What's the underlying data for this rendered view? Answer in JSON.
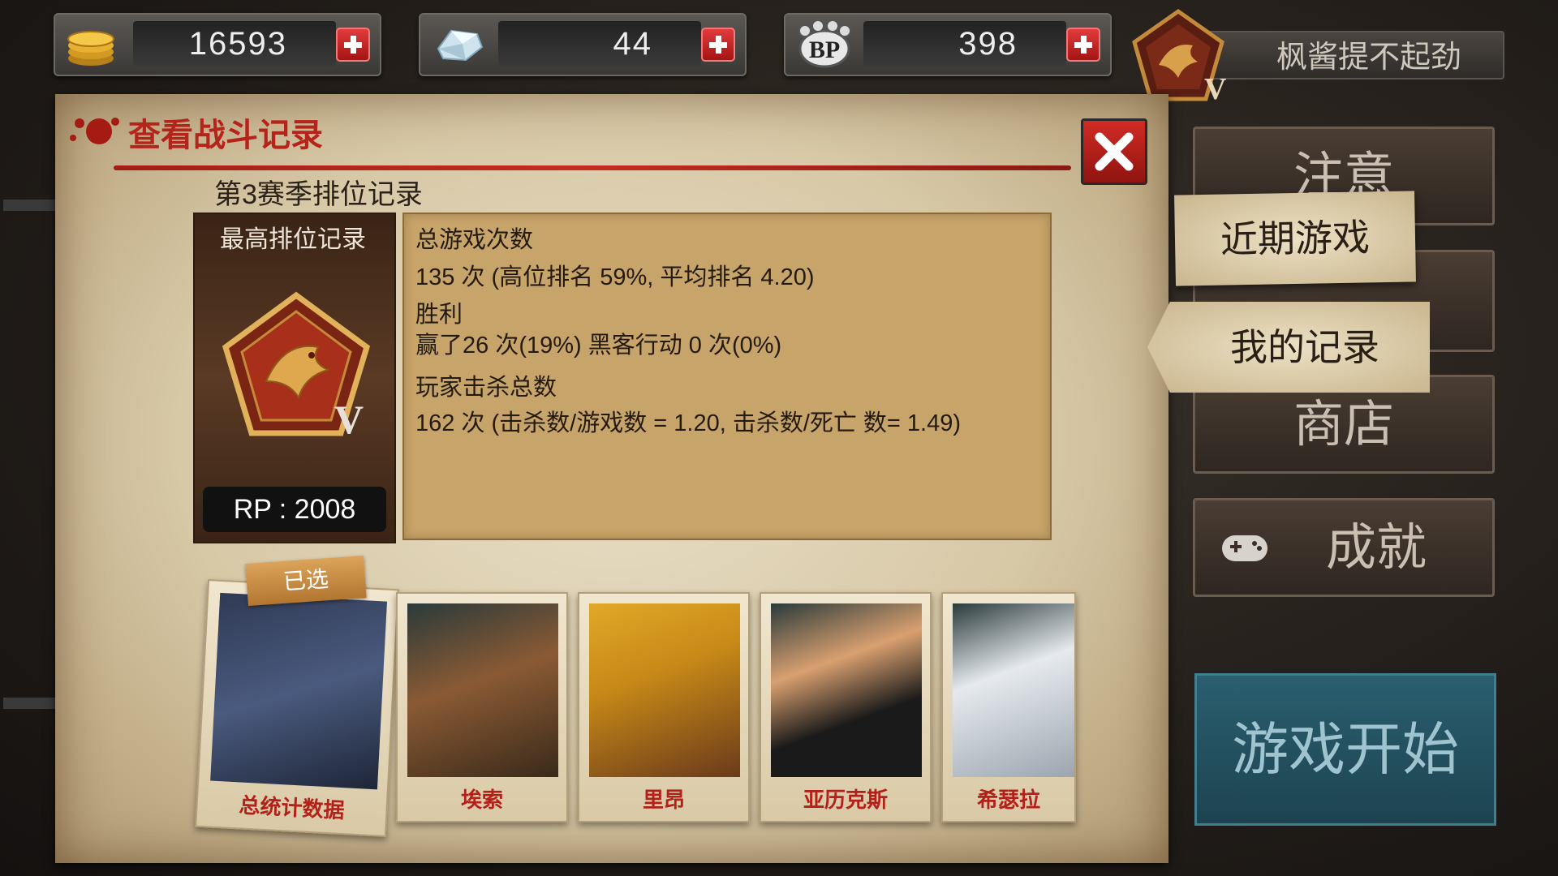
{
  "currency": {
    "gold": {
      "icon": "gold-coins-icon",
      "value": "16593"
    },
    "gem": {
      "icon": "crystal-icon",
      "value": "44"
    },
    "bp": {
      "icon": "bp-paw-icon",
      "value": "398"
    }
  },
  "player": {
    "name": "枫酱提不起劲",
    "rank_tier": "V"
  },
  "dialog": {
    "title": "查看战斗记录",
    "season_title": "第3赛季排位记录",
    "best_rank": {
      "label": "最高排位记录",
      "tier": "V",
      "rp": "RP : 2008"
    },
    "stats": {
      "games_label": "总游戏次数",
      "games_value": "135 次 (高位排名 59%, 平均排名 4.20)",
      "wins_label": "胜利",
      "wins_value": "赢了26 次(19%) 黑客行动 0 次(0%)",
      "kills_label": "玩家击杀总数",
      "kills_value": "162 次 (击杀数/游戏数 = 1.20, 击杀数/死亡 数= 1.49)"
    },
    "selected_badge": "已选",
    "characters": [
      {
        "name": "总统计数据",
        "color": "#3a4a6a"
      },
      {
        "name": "埃索",
        "color": "#6a4a2a"
      },
      {
        "name": "里昂",
        "color": "#d9a020"
      },
      {
        "name": "亚历克斯",
        "color": "#2a2a2a"
      },
      {
        "name": "希瑟拉",
        "color": "#cfd6de"
      }
    ]
  },
  "menu": {
    "notice": "注意",
    "recent_games": "近期游戏",
    "my_records": "我的记录",
    "shop": "商店",
    "achievements": "成就",
    "start_game": "游戏开始"
  }
}
